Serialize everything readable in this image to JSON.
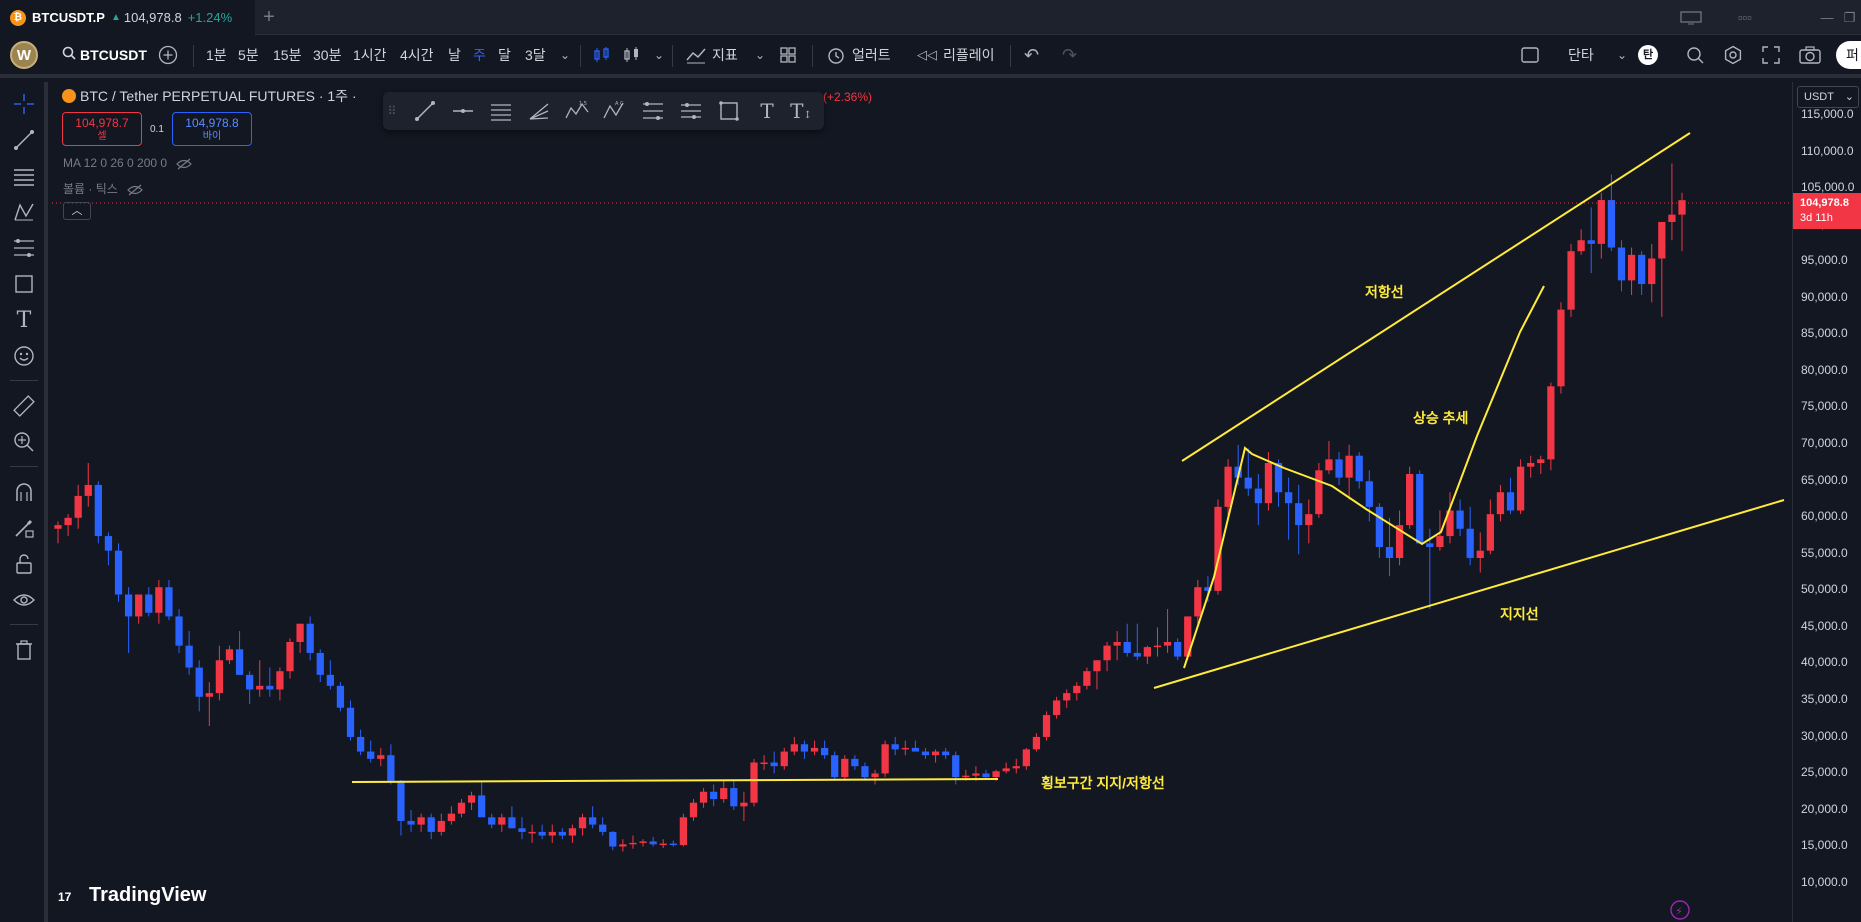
{
  "browser_tab": {
    "symbol": "BTCUSDT.P",
    "price": "104,978.8",
    "change": "+1.24%"
  },
  "header": {
    "avatar_letter": "W",
    "symbol": "BTCUSDT",
    "intervals": [
      "1분",
      "5분",
      "15분",
      "30분",
      "1시간",
      "4시간",
      "날",
      "주",
      "달",
      "3달"
    ],
    "active_interval": "주",
    "indicators_label": "지표",
    "alert_label": "얼러트",
    "replay_label": "리플레이",
    "layout_label": "단타",
    "layout_badge": "탄",
    "publish_label": "퍼"
  },
  "legend": {
    "title_prefix": "BTC / Tether PERPETUAL FUTURES · 1주 · ",
    "title_suffix": "(+2.36%)",
    "sell_price": "104,978.7",
    "sell_label": "셀",
    "spread": "0.1",
    "buy_price": "104,978.8",
    "buy_label": "바이",
    "ma_line": "MA 12 0 26 0 200 0",
    "volume_line": "볼륨 · 틱스"
  },
  "price_axis": {
    "currency": "USDT",
    "labels": [
      "115,000.0",
      "110,000.0",
      "105,000.0",
      "100,000.0",
      "95,000.0",
      "90,000.0",
      "85,000.0",
      "80,000.0",
      "75,000.0",
      "70,000.0",
      "65,000.0",
      "60,000.0",
      "55,000.0",
      "50,000.0",
      "45,000.0",
      "40,000.0",
      "35,000.0",
      "30,000.0",
      "25,000.0",
      "20,000.0",
      "15,000.0",
      "10,000.0"
    ],
    "current_price": "104,978.8",
    "countdown": "3d 11h"
  },
  "annotations": {
    "resistance": "저항선",
    "uptrend": "상승 추세",
    "support": "지지선",
    "range": "횡보구간 지지/저항선"
  },
  "watermark": "TradingView",
  "colors": {
    "background": "#131722",
    "up": "#f23645",
    "down": "#2962ff",
    "drawing": "#ffeb3b"
  },
  "chart_data": {
    "type": "candlestick",
    "ylim": [
      10000,
      115000
    ],
    "candles": [
      [
        60000,
        61000,
        58000,
        60500
      ],
      [
        60500,
        62000,
        59000,
        61500
      ],
      [
        61500,
        66000,
        60000,
        64500
      ],
      [
        64500,
        69000,
        63000,
        66000
      ],
      [
        66000,
        66500,
        58000,
        59000
      ],
      [
        59000,
        59500,
        55000,
        57000
      ],
      [
        57000,
        58000,
        50000,
        51000
      ],
      [
        51000,
        52000,
        43000,
        48000
      ],
      [
        48000,
        51000,
        47000,
        51000
      ],
      [
        51000,
        52000,
        48000,
        48500
      ],
      [
        48500,
        53000,
        47000,
        52000
      ],
      [
        52000,
        53000,
        47500,
        48000
      ],
      [
        48000,
        49000,
        43000,
        44000
      ],
      [
        44000,
        46000,
        40000,
        41000
      ],
      [
        41000,
        42000,
        35000,
        37000
      ],
      [
        37000,
        39000,
        33000,
        37500
      ],
      [
        37500,
        44000,
        36500,
        42000
      ],
      [
        42000,
        44000,
        41500,
        43500
      ],
      [
        43500,
        46000,
        40000,
        40000
      ],
      [
        40000,
        40500,
        36000,
        38000
      ],
      [
        38000,
        42000,
        37000,
        38500
      ],
      [
        38500,
        41000,
        37000,
        38000
      ],
      [
        38000,
        41000,
        36500,
        40500
      ],
      [
        40500,
        45000,
        39500,
        44500
      ],
      [
        44500,
        47000,
        43000,
        47000
      ],
      [
        47000,
        48000,
        42000,
        43000
      ],
      [
        43000,
        43500,
        39000,
        40000
      ],
      [
        40000,
        42000,
        38000,
        38500
      ],
      [
        38500,
        39000,
        35000,
        35500
      ],
      [
        35500,
        36500,
        31000,
        31500
      ],
      [
        31500,
        32500,
        29000,
        29500
      ],
      [
        29500,
        31000,
        28000,
        28500
      ],
      [
        28500,
        30000,
        27500,
        29000
      ],
      [
        29000,
        30500,
        25000,
        25500
      ],
      [
        25500,
        25600,
        18000,
        20000
      ],
      [
        20000,
        21500,
        18500,
        19500
      ],
      [
        19500,
        21000,
        18500,
        20500
      ],
      [
        20500,
        21000,
        17500,
        18500
      ],
      [
        18500,
        21000,
        18000,
        20000
      ],
      [
        20000,
        22000,
        19500,
        21000
      ],
      [
        21000,
        23000,
        20500,
        22500
      ],
      [
        22500,
        24000,
        21500,
        23500
      ],
      [
        23500,
        25500,
        21000,
        20500
      ],
      [
        20500,
        21000,
        19000,
        19500
      ],
      [
        19500,
        21000,
        18500,
        20500
      ],
      [
        20500,
        22000,
        19000,
        19000
      ],
      [
        19000,
        20500,
        17500,
        18500
      ],
      [
        18500,
        19500,
        17000,
        18500
      ],
      [
        18500,
        19500,
        17500,
        18000
      ],
      [
        18000,
        19500,
        17000,
        18500
      ],
      [
        18500,
        19000,
        17500,
        18000
      ],
      [
        18000,
        19500,
        17000,
        19000
      ],
      [
        19000,
        21000,
        18000,
        20500
      ],
      [
        20500,
        22000,
        19000,
        19500
      ],
      [
        19500,
        20500,
        18000,
        18500
      ],
      [
        18500,
        18600,
        16000,
        16500
      ],
      [
        16500,
        17500,
        15800,
        16800
      ],
      [
        16800,
        18000,
        16200,
        17000
      ],
      [
        17000,
        17500,
        16500,
        17200
      ],
      [
        17200,
        17800,
        16500,
        16800
      ],
      [
        16800,
        17500,
        16300,
        16900
      ],
      [
        16900,
        17300,
        16500,
        16700
      ],
      [
        16700,
        21000,
        16500,
        20500
      ],
      [
        20500,
        23000,
        20000,
        22500
      ],
      [
        22500,
        24500,
        21800,
        24000
      ],
      [
        24000,
        25000,
        22000,
        23000
      ],
      [
        23000,
        25500,
        22500,
        24500
      ],
      [
        24500,
        25500,
        21500,
        22000
      ],
      [
        22000,
        24000,
        20000,
        22500
      ],
      [
        22500,
        28500,
        22000,
        28000
      ],
      [
        28000,
        29000,
        27000,
        28000
      ],
      [
        28000,
        29500,
        26500,
        27500
      ],
      [
        27500,
        30000,
        27000,
        29500
      ],
      [
        29500,
        31500,
        29000,
        30500
      ],
      [
        30500,
        31000,
        28500,
        29500
      ],
      [
        29500,
        31000,
        29000,
        30000
      ],
      [
        30000,
        31000,
        28500,
        29000
      ],
      [
        29000,
        29500,
        25500,
        26000
      ],
      [
        26000,
        29000,
        25500,
        28500
      ],
      [
        28500,
        29000,
        27000,
        27500
      ],
      [
        27500,
        28000,
        25500,
        26000
      ],
      [
        26000,
        27000,
        25000,
        26500
      ],
      [
        26500,
        31000,
        26000,
        30500
      ],
      [
        30500,
        31500,
        29000,
        29800
      ],
      [
        29800,
        31000,
        29000,
        30000
      ],
      [
        30000,
        31000,
        29500,
        29500
      ],
      [
        29500,
        30000,
        28500,
        29000
      ],
      [
        29000,
        29800,
        28000,
        29500
      ],
      [
        29500,
        30000,
        28500,
        29000
      ],
      [
        29000,
        29500,
        25000,
        26000
      ],
      [
        26000,
        27000,
        25500,
        26200
      ],
      [
        26200,
        27500,
        25500,
        26500
      ],
      [
        26500,
        27000,
        25800,
        26000
      ],
      [
        26000,
        27000,
        25500,
        26800
      ],
      [
        26800,
        28000,
        26500,
        27200
      ],
      [
        27200,
        28500,
        26500,
        27500
      ],
      [
        27500,
        30000,
        27000,
        29800
      ],
      [
        29800,
        32000,
        29500,
        31500
      ],
      [
        31500,
        35000,
        31000,
        34500
      ],
      [
        34500,
        37000,
        34000,
        36500
      ],
      [
        36500,
        38000,
        35500,
        37500
      ],
      [
        37500,
        39000,
        36500,
        38500
      ],
      [
        38500,
        41000,
        38000,
        40500
      ],
      [
        40500,
        42000,
        38000,
        42000
      ],
      [
        42000,
        44500,
        40500,
        44000
      ],
      [
        44000,
        46000,
        42000,
        44500
      ],
      [
        44500,
        47000,
        42500,
        43000
      ],
      [
        43000,
        47000,
        42000,
        42500
      ],
      [
        42500,
        44000,
        41500,
        43800
      ],
      [
        43800,
        46500,
        42500,
        44000
      ],
      [
        44000,
        49000,
        43000,
        44500
      ],
      [
        44500,
        45000,
        42000,
        42500
      ],
      [
        42500,
        48000,
        42000,
        48000
      ],
      [
        48000,
        53000,
        47000,
        52000
      ],
      [
        52000,
        53500,
        50000,
        51500
      ],
      [
        51500,
        64000,
        51000,
        63000
      ],
      [
        63000,
        69500,
        61500,
        68500
      ],
      [
        68500,
        71500,
        66000,
        67000
      ],
      [
        67000,
        71000,
        64500,
        65500
      ],
      [
        65500,
        67500,
        60500,
        63500
      ],
      [
        63500,
        70500,
        62500,
        69000
      ],
      [
        69000,
        69500,
        63000,
        65000
      ],
      [
        65000,
        67000,
        58500,
        63500
      ],
      [
        63500,
        66000,
        56500,
        60500
      ],
      [
        60500,
        64000,
        58000,
        62000
      ],
      [
        62000,
        69000,
        61500,
        68000
      ],
      [
        68000,
        72000,
        67500,
        69500
      ],
      [
        69500,
        70500,
        66000,
        67000
      ],
      [
        67000,
        71500,
        64000,
        70000
      ],
      [
        70000,
        70500,
        65500,
        66500
      ],
      [
        66500,
        68000,
        61000,
        63000
      ],
      [
        63000,
        63500,
        56000,
        57500
      ],
      [
        57500,
        61500,
        53500,
        56000
      ],
      [
        56000,
        62500,
        55000,
        60500
      ],
      [
        60500,
        68500,
        60000,
        67500
      ],
      [
        67500,
        68000,
        58000,
        58000
      ],
      [
        58000,
        60000,
        49000,
        57500
      ],
      [
        57500,
        62500,
        57000,
        59000
      ],
      [
        59000,
        65000,
        58000,
        62500
      ],
      [
        62500,
        64000,
        59000,
        60000
      ],
      [
        60000,
        63000,
        55000,
        56000
      ],
      [
        56000,
        59500,
        54000,
        57000
      ],
      [
        57000,
        64000,
        56500,
        62000
      ],
      [
        62000,
        66000,
        61000,
        65000
      ],
      [
        65000,
        67000,
        62000,
        62500
      ],
      [
        62500,
        69500,
        62000,
        68500
      ],
      [
        68500,
        70000,
        67000,
        69000
      ],
      [
        69000,
        70000,
        67500,
        69500
      ],
      [
        69500,
        80000,
        68000,
        79500
      ],
      [
        79500,
        91000,
        78500,
        90000
      ],
      [
        90000,
        99000,
        89000,
        98000
      ],
      [
        98000,
        101000,
        97500,
        99500
      ],
      [
        99500,
        104000,
        95000,
        99000
      ],
      [
        99000,
        106000,
        97000,
        105000
      ],
      [
        105000,
        108500,
        98000,
        98500
      ],
      [
        98500,
        99500,
        92500,
        94000
      ],
      [
        94000,
        98500,
        92000,
        97500
      ],
      [
        97500,
        98000,
        92000,
        93500
      ],
      [
        93500,
        99000,
        91000,
        97000
      ],
      [
        97000,
        102000,
        89000,
        102000
      ],
      [
        102000,
        110000,
        99500,
        103000
      ],
      [
        103000,
        106000,
        98000,
        104978
      ]
    ]
  }
}
